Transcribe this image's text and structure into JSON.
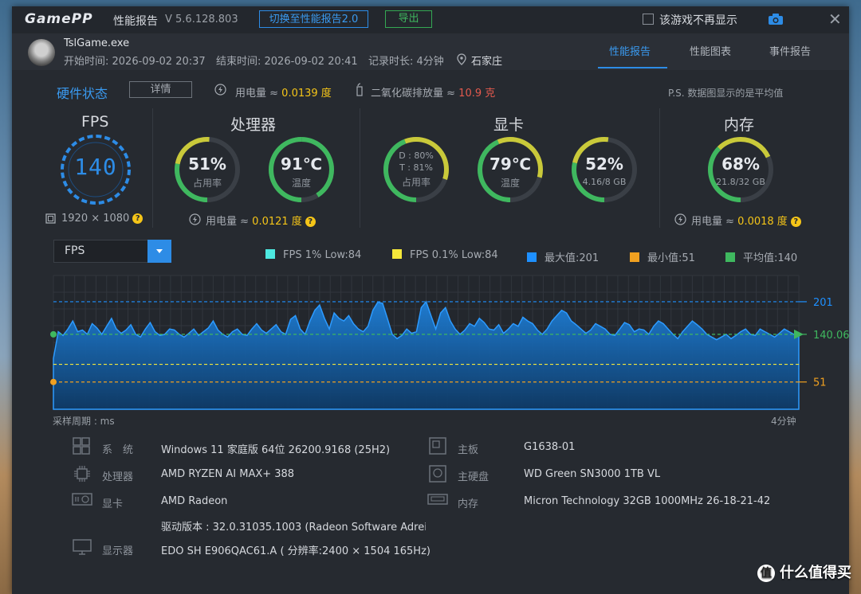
{
  "app": {
    "logo": "GamePP",
    "title": "性能报告",
    "version": "V 5.6.128.803",
    "switch_btn": "切换至性能报告2.0",
    "export_btn": "导出",
    "dont_show": "该游戏不再显示",
    "close": "✕"
  },
  "session": {
    "exe": "TslGame.exe",
    "start": "开始时间: 2026-09-02 20:37",
    "end": "结束时间: 2026-09-02 20:41",
    "duration": "记录时长: 4分钟",
    "location": "石家庄"
  },
  "tabs": [
    {
      "label": "性能报告"
    },
    {
      "label": "性能图表"
    },
    {
      "label": "事件报告"
    }
  ],
  "hardware": {
    "title": "硬件状态",
    "detail_btn": "详情",
    "power_label": "用电量 ≈ ",
    "power_value": "0.0139 度",
    "co2_label": "二氧化碳排放量 ≈ ",
    "co2_value": "10.9 克",
    "ps_note": "P.S. 数据图显示的是平均值"
  },
  "sections": {
    "fps": "FPS",
    "cpu": "处理器",
    "gpu": "显卡",
    "mem": "内存"
  },
  "fps": {
    "value": "140",
    "resolution": "1920 × 1080"
  },
  "cpu": {
    "usage": "51%",
    "usage_label": "占用率",
    "usage_frac": 0.51,
    "temp": "91℃",
    "temp_label": "温度",
    "temp_frac": 0.91,
    "power_label": "用电量 ≈ ",
    "power_value": "0.0121 度"
  },
  "gpu": {
    "d": "D : 80%",
    "t": "T : 81%",
    "usage_label": "占用率",
    "usage_frac": 0.8,
    "temp": "79℃",
    "temp_label": "温度",
    "temp_frac": 0.79,
    "vram": "52%",
    "vram_detail": "4.16/8 GB",
    "vram_frac": 0.52
  },
  "mem": {
    "usage": "68%",
    "detail": "21.8/32 GB",
    "usage_frac": 0.68,
    "power_label": "用电量 ≈ ",
    "power_value": "0.0018 度"
  },
  "selector": {
    "value": "FPS"
  },
  "legend": [
    {
      "label": "FPS 1% Low:84",
      "color": "#4de8e0"
    },
    {
      "label": "FPS 0.1% Low:84",
      "color": "#f5e83a"
    },
    {
      "label": "最大值:201",
      "color": "#1e90ff"
    },
    {
      "label": "最小值:51",
      "color": "#f0a020"
    },
    {
      "label": "平均值:140",
      "color": "#3fb85f"
    }
  ],
  "chart_data": {
    "type": "area",
    "ylim": [
      0,
      250
    ],
    "max": 201,
    "min": 51,
    "avg": 140.06,
    "low1": 84,
    "low01": 84,
    "max_label": "201",
    "min_label": "51",
    "avg_label": "140.06",
    "x_start_label": "采样周期 : ms",
    "x_end_label": "4分钟",
    "values": [
      95,
      145,
      138,
      150,
      165,
      145,
      148,
      140,
      160,
      152,
      140,
      155,
      170,
      150,
      142,
      148,
      158,
      140,
      135,
      150,
      162,
      145,
      138,
      140,
      150,
      148,
      140,
      135,
      142,
      150,
      138,
      145,
      152,
      165,
      148,
      140,
      135,
      145,
      150,
      140,
      138,
      150,
      160,
      148,
      142,
      150,
      158,
      145,
      140,
      168,
      175,
      150,
      140,
      165,
      185,
      195,
      170,
      150,
      180,
      170,
      165,
      175,
      160,
      150,
      145,
      155,
      185,
      200,
      198,
      170,
      140,
      132,
      138,
      150,
      142,
      145,
      190,
      201,
      175,
      150,
      180,
      190,
      165,
      150,
      140,
      148,
      160,
      155,
      170,
      162,
      150,
      148,
      158,
      142,
      150,
      160,
      155,
      172,
      165,
      160,
      148,
      140,
      150,
      165,
      175,
      185,
      180,
      165,
      158,
      150,
      142,
      148,
      160,
      155,
      150,
      140,
      138,
      150,
      162,
      158,
      145,
      150,
      148,
      140,
      155,
      165,
      160,
      150,
      140,
      132,
      145,
      155,
      165,
      158,
      150,
      140,
      135,
      130,
      135,
      140,
      132,
      138,
      145,
      150,
      140,
      138,
      150,
      145,
      140,
      135,
      142,
      150,
      145,
      140,
      138
    ]
  },
  "specs": [
    {
      "key": "系　统",
      "value": "Windows 11 家庭版 64位 26200.9168 (25H2)"
    },
    {
      "key": "处理器",
      "value": "AMD RYZEN AI MAX+ 388"
    },
    {
      "key": "显卡",
      "value": "AMD Radeon"
    },
    {
      "key": "",
      "value": "驱动版本 : 32.0.31035.1003 (Radeon Software Adrei"
    },
    {
      "key": "显示器",
      "value": "EDO SH E906QAC61.A ( 分辨率:2400 × 1504 165Hz)"
    },
    {
      "key": "主板",
      "value": "G1638-01"
    },
    {
      "key": "主硬盘",
      "value": "WD Green SN3000 1TB VL"
    },
    {
      "key": "内存",
      "value": "Micron Technology 32GB 1000MHz 26-18-21-42"
    }
  ],
  "watermark": {
    "badge": "值",
    "text": "什么值得买"
  },
  "colors": {
    "accent": "#2d8ce6",
    "green": "#3fb85f",
    "yellow": "#f5c518",
    "orange": "#f0a020",
    "panel": "#262a30"
  }
}
